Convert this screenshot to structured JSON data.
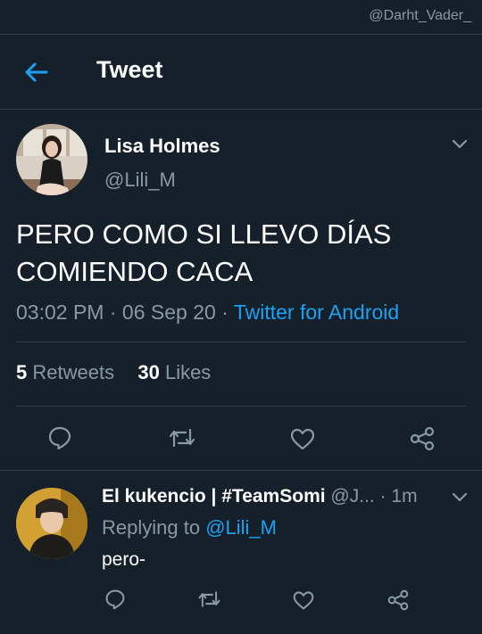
{
  "watermark": "@Darht_Vader_",
  "header": {
    "title": "Tweet"
  },
  "tweet": {
    "author_name": "Lisa Holmes",
    "author_handle": "@Lili_M",
    "text_line1": "PERO COMO SI LLEVO DÍAS",
    "text_line2": "COMIENDO CACA",
    "time": "03:02 PM",
    "date": "06 Sep 20",
    "separator": "·",
    "source": "Twitter for Android",
    "retweets_count": "5",
    "retweets_label": "Retweets",
    "likes_count": "30",
    "likes_label": "Likes"
  },
  "reply": {
    "author_name": "El kukencio | #TeamSomi",
    "author_handle": "@J...",
    "time": "· 1m",
    "replying_prefix": "Replying to",
    "replying_to": "@Lili_M",
    "text": "pero-"
  },
  "colors": {
    "background": "#15202b",
    "accent": "#1da1f2",
    "secondary_text": "#8899a6",
    "divider": "#2f3d4b"
  },
  "icons": [
    "arrow-left-icon",
    "chevron-down-icon",
    "reply-icon",
    "retweet-icon",
    "like-icon",
    "share-icon"
  ]
}
